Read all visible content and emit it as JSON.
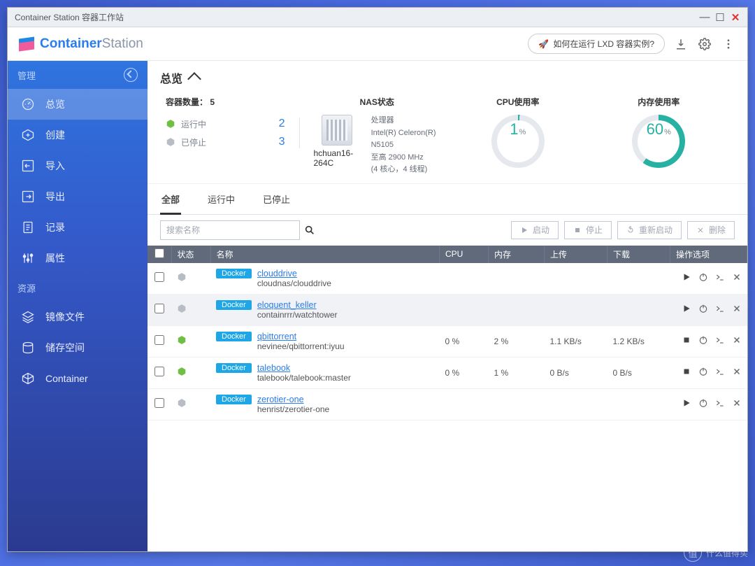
{
  "window": {
    "title": "Container Station 容器工作站"
  },
  "brand": {
    "part1": "Container",
    "part2": "Station"
  },
  "header": {
    "help_label": "如何在运行 LXD 容器实例?",
    "rocket_icon": "🚀"
  },
  "sidebar": {
    "section_manage": "管理",
    "section_resource": "资源",
    "items_manage": [
      {
        "label": "总览",
        "icon": "dashboard-icon",
        "active": true
      },
      {
        "label": "创建",
        "icon": "plus-icon"
      },
      {
        "label": "导入",
        "icon": "import-icon"
      },
      {
        "label": "导出",
        "icon": "export-icon"
      },
      {
        "label": "记录",
        "icon": "log-icon"
      },
      {
        "label": "属性",
        "icon": "sliders-icon"
      }
    ],
    "items_resource": [
      {
        "label": "镜像文件",
        "icon": "layers-icon"
      },
      {
        "label": "储存空间",
        "icon": "disk-icon"
      },
      {
        "label": "Container",
        "icon": "cube-icon"
      }
    ]
  },
  "page": {
    "title": "总览"
  },
  "stats": {
    "count_label": "容器数量：",
    "count_value": "5",
    "running_label": "运行中",
    "running_value": "2",
    "stopped_label": "已停止",
    "stopped_value": "3",
    "nas_label": "NAS状态",
    "nas_name": "hchuan16-264C",
    "cpu_title": "处理器",
    "cpu_model": "Intel(R) Celeron(R) N5105",
    "cpu_freq": "至高 2900 MHz",
    "cpu_cores": "(4 核心，4 线程)",
    "cpu_usage_label": "CPU使用率",
    "cpu_usage": "1",
    "mem_usage_label": "内存使用率",
    "mem_usage": "60",
    "pct": "%"
  },
  "tabs": {
    "all": "全部",
    "running": "运行中",
    "stopped": "已停止"
  },
  "search": {
    "placeholder": "搜索名称"
  },
  "toolbar": {
    "start": "启动",
    "stop": "停止",
    "restart": "重新启动",
    "remove": "删除"
  },
  "columns": {
    "status": "状态",
    "name": "名称",
    "cpu": "CPU",
    "mem": "内存",
    "up": "上传",
    "down": "下载",
    "ops": "操作选项"
  },
  "rows": [
    {
      "state": "stopped",
      "badge": "Docker",
      "name": "clouddrive",
      "image": "cloudnas/clouddrive",
      "cpu": "",
      "mem": "",
      "up": "",
      "down": ""
    },
    {
      "state": "stopped",
      "badge": "Docker",
      "name": "eloquent_keller",
      "image": "containrrr/watchtower",
      "cpu": "",
      "mem": "",
      "up": "",
      "down": "",
      "hover": true
    },
    {
      "state": "running",
      "badge": "Docker",
      "name": "qbittorrent",
      "image": "nevinee/qbittorrent:iyuu",
      "cpu": "0 %",
      "mem": "2 %",
      "up": "1.1 KB/s",
      "down": "1.2 KB/s"
    },
    {
      "state": "running",
      "badge": "Docker",
      "name": "talebook",
      "image": "talebook/talebook:master",
      "cpu": "0 %",
      "mem": "1 %",
      "up": "0 B/s",
      "down": "0 B/s"
    },
    {
      "state": "stopped",
      "badge": "Docker",
      "name": "zerotier-one",
      "image": "henrist/zerotier-one",
      "cpu": "",
      "mem": "",
      "up": "",
      "down": ""
    }
  ],
  "colors": {
    "accent": "#2b7de9",
    "teal": "#26b1a2",
    "running": "#6fbf44",
    "stopped": "#b7bcc5"
  },
  "watermark": {
    "char": "值",
    "text": "什么值得买"
  }
}
